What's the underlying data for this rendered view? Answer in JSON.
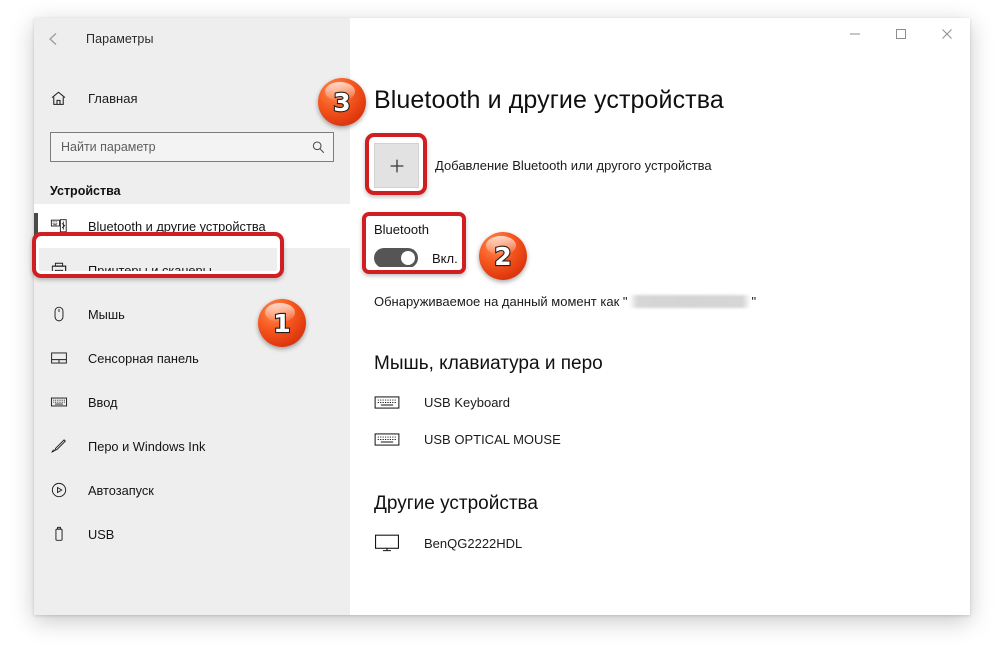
{
  "window": {
    "app_title": "Параметры",
    "back_icon": "back-arrow-icon",
    "controls": {
      "minimize": "minimize-icon",
      "maximize": "maximize-icon",
      "close": "close-icon"
    }
  },
  "sidebar": {
    "home_label": "Главная",
    "home_icon": "home-icon",
    "search": {
      "placeholder": "Найти параметр",
      "value": "",
      "icon": "search-icon"
    },
    "section_title": "Устройства",
    "items": [
      {
        "label": "Bluetooth и другие устройства",
        "icon": "bluetooth-devices-icon",
        "selected": true
      },
      {
        "label": "Принтеры и сканеры",
        "icon": "printer-icon",
        "selected": false
      },
      {
        "label": "Мышь",
        "icon": "mouse-icon",
        "selected": false
      },
      {
        "label": "Сенсорная панель",
        "icon": "touchpad-icon",
        "selected": false
      },
      {
        "label": "Ввод",
        "icon": "keyboard-icon",
        "selected": false
      },
      {
        "label": "Перо и Windows Ink",
        "icon": "pen-icon",
        "selected": false
      },
      {
        "label": "Автозапуск",
        "icon": "autoplay-icon",
        "selected": false
      },
      {
        "label": "USB",
        "icon": "usb-icon",
        "selected": false
      }
    ]
  },
  "main": {
    "page_title": "Bluetooth и другие устройства",
    "add_device": {
      "button_icon": "plus-icon",
      "label": "Добавление Bluetooth или другого устройства"
    },
    "bluetooth": {
      "name": "Bluetooth",
      "state": "Вкл.",
      "toggle_on": true
    },
    "discoverable": {
      "prefix": "Обнаруживаемое на данный момент как \"",
      "suffix": "\"",
      "device_name_redacted": true
    },
    "groups": [
      {
        "title": "Мышь, клавиатура и перо",
        "devices": [
          {
            "name": "USB Keyboard",
            "icon": "keyboard-icon"
          },
          {
            "name": "USB OPTICAL MOUSE",
            "icon": "keyboard-icon"
          }
        ]
      },
      {
        "title": "Другие устройства",
        "devices": [
          {
            "name": "BenQG2222HDL",
            "icon": "monitor-icon"
          }
        ]
      }
    ]
  },
  "annotations": {
    "accent_color": "#cf1f22",
    "badge_color": "#f6591f",
    "badges": [
      {
        "number": "1"
      },
      {
        "number": "2"
      },
      {
        "number": "3"
      }
    ]
  }
}
